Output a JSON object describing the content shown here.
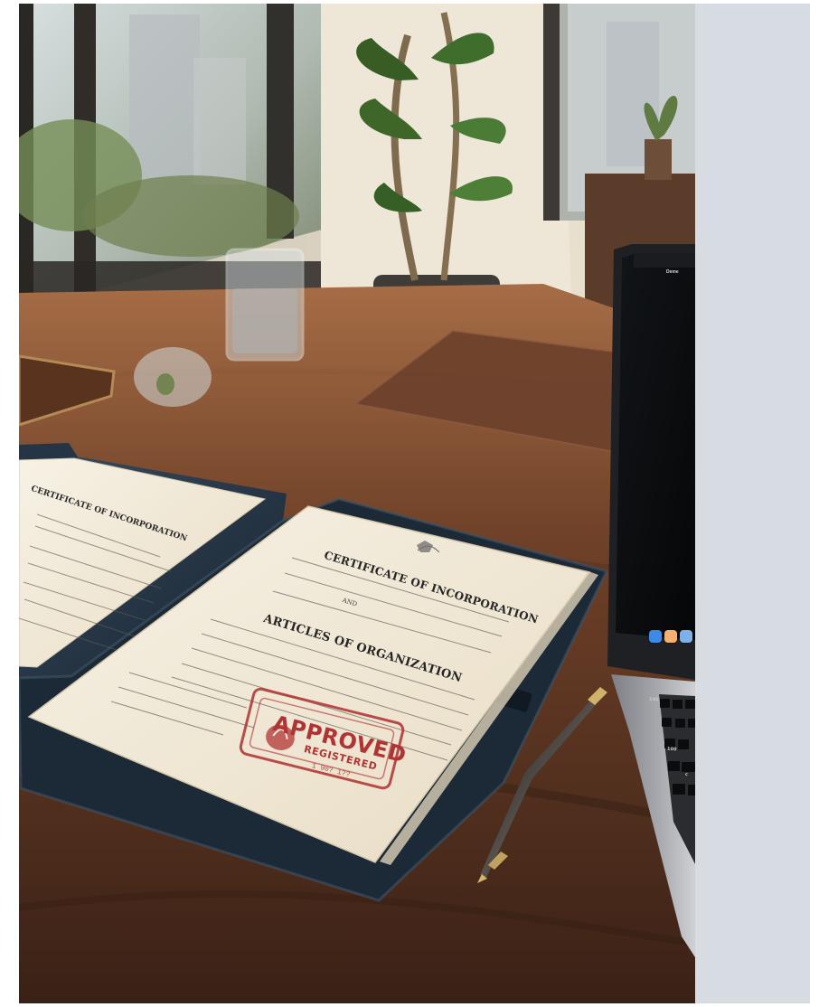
{
  "scene": {
    "foreground_papers": {
      "left_certificate_title": "CERTIFICATE OF INCORPORATION",
      "right_certificate_title": "CERTIFICATE OF INCORPORATION",
      "connector": "AND",
      "articles_title": "ARTICLES OF ORGANIZATION"
    },
    "stamp": {
      "main": "APPROVED",
      "sub": "REGISTERED",
      "date": "1 90? 1??"
    },
    "laptop": {
      "menu_symbol": "",
      "menu_app": "Deme",
      "keys": [
        "140",
        "100",
        "c"
      ]
    },
    "colors": {
      "wood_dark": "#3b2418",
      "wood_mid": "#6a4028",
      "wood_light": "#9a6341",
      "paper": "#efe8d7",
      "leather": "#223040",
      "stamp_red": "#b03434",
      "side_panel": "#d7dce3"
    }
  }
}
